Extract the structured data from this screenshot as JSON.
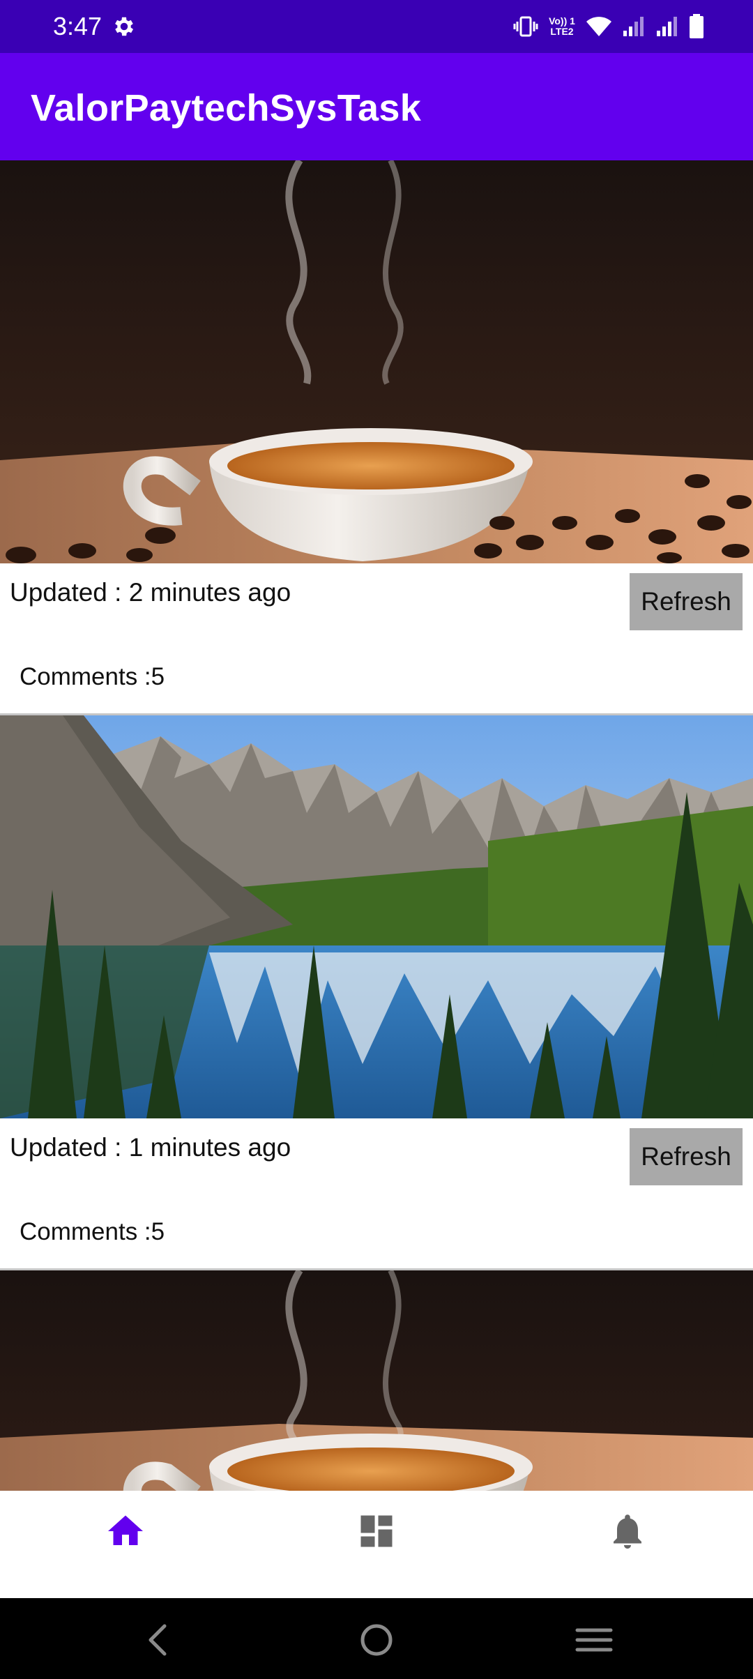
{
  "status_bar": {
    "time": "3:47",
    "volte_line1": "Vo)) 1",
    "volte_line2": "LTE2",
    "icons": [
      "settings-gear-icon",
      "vibrate-icon",
      "volte-icon",
      "wifi-icon",
      "signal-icon",
      "signal-icon",
      "battery-icon"
    ]
  },
  "app_bar": {
    "title": "ValorPaytechSysTask"
  },
  "feed": {
    "items": [
      {
        "image": "coffee-cup-photo",
        "updated": "Updated : 2 minutes ago",
        "refresh_label": "Refresh",
        "comments": "Comments :5"
      },
      {
        "image": "mountain-lake-photo",
        "updated": "Updated : 1 minutes ago",
        "refresh_label": "Refresh",
        "comments": "Comments :5"
      },
      {
        "image": "coffee-cup-photo"
      }
    ]
  },
  "bottom_nav": {
    "items": [
      {
        "icon": "home-icon",
        "selected": true
      },
      {
        "icon": "dashboard-icon",
        "selected": false
      },
      {
        "icon": "notifications-bell-icon",
        "selected": false
      }
    ]
  },
  "system_nav": {
    "buttons": [
      "back-icon",
      "home-circle-icon",
      "menu-icon"
    ]
  },
  "colors": {
    "status_bar": "#3a00b4",
    "app_bar": "#6200ee",
    "nav_selected": "#6200ee",
    "nav_unselected": "#666666",
    "refresh_button": "#a9a9a9",
    "system_nav": "#000000"
  }
}
